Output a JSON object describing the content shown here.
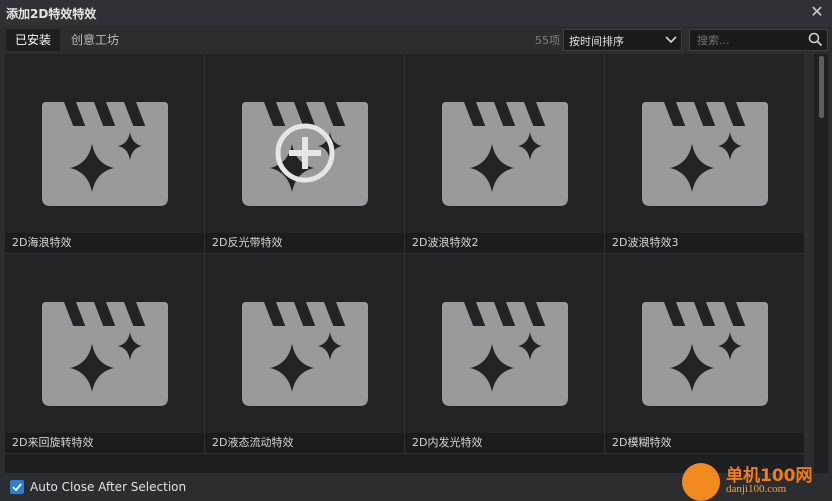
{
  "window": {
    "title": "添加2D特效特效"
  },
  "tabs": [
    {
      "label": "已安装",
      "active": true
    },
    {
      "label": "创意工坊",
      "active": false
    }
  ],
  "toolbar": {
    "count": "55项",
    "sort_selected": "按时间排序",
    "search_placeholder": "搜索..."
  },
  "effects": [
    {
      "name": "2D海浪特效",
      "hover_add": false
    },
    {
      "name": "2D反光带特效",
      "hover_add": true
    },
    {
      "name": "2D波浪特效2",
      "hover_add": false
    },
    {
      "name": "2D波浪特效3",
      "hover_add": false
    },
    {
      "name": "2D来回旋转特效",
      "hover_add": false
    },
    {
      "name": "2D液态流动特效",
      "hover_add": false
    },
    {
      "name": "2D内发光特效",
      "hover_add": false
    },
    {
      "name": "2D模糊特效",
      "hover_add": false
    }
  ],
  "footer": {
    "auto_close_label": "Auto Close After Selection",
    "auto_close_checked": true
  },
  "watermark": {
    "line1": "单机100网",
    "line2": "danji100.com"
  },
  "colors": {
    "accent": "#2e7ed6",
    "icon": "#9a9a9a",
    "background": "#1e1f22"
  }
}
